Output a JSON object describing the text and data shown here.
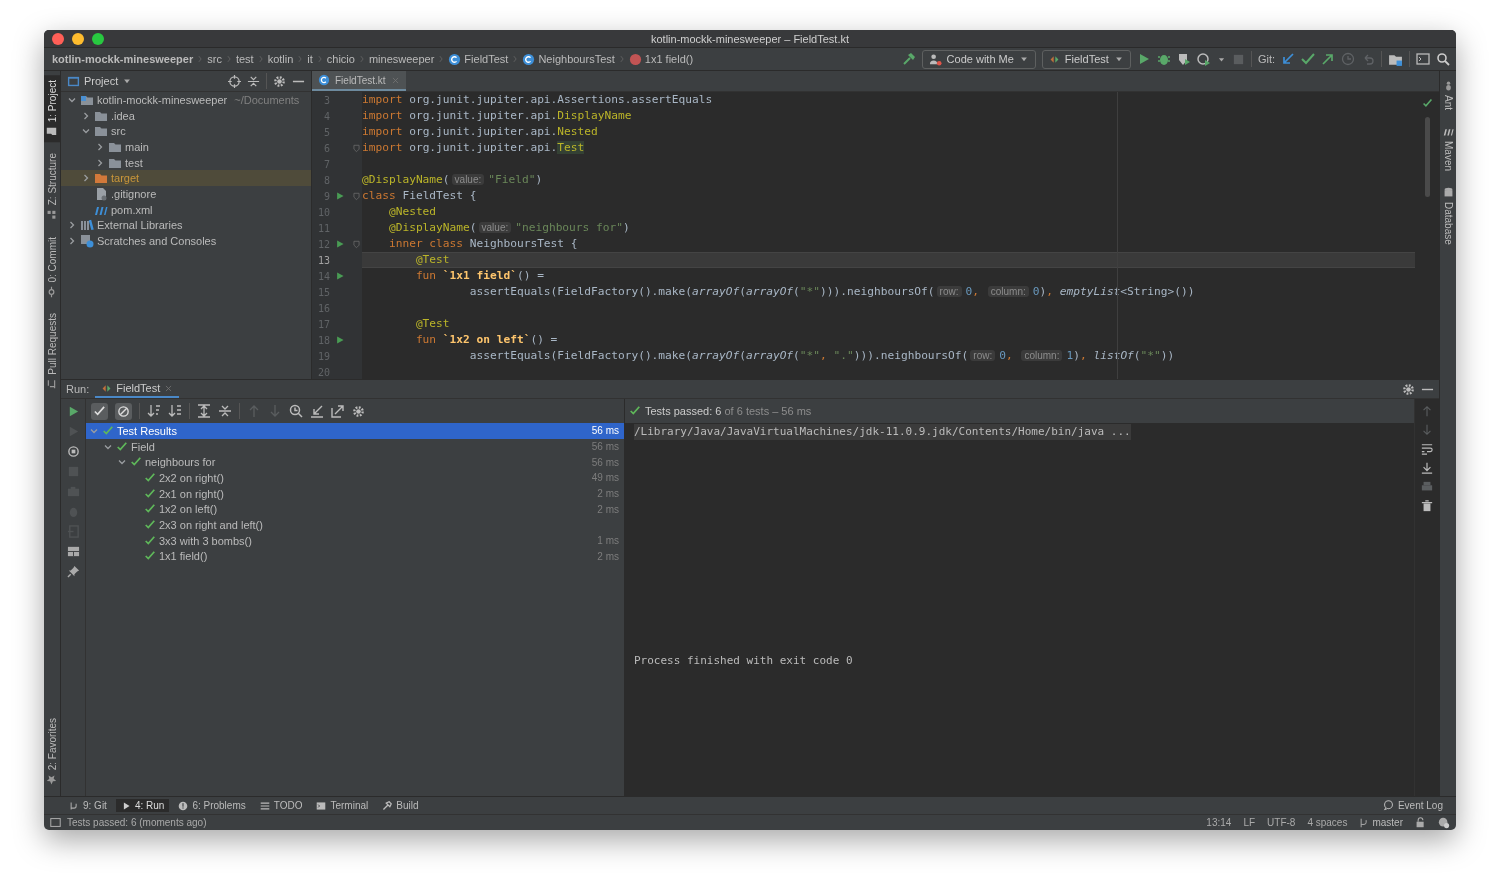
{
  "window": {
    "title": "kotlin-mockk-minesweeper – FieldTest.kt"
  },
  "breadcrumbs": [
    {
      "label": "kotlin-mockk-minesweeper",
      "kind": "project"
    },
    {
      "label": "src",
      "kind": "package"
    },
    {
      "label": "test",
      "kind": "package"
    },
    {
      "label": "kotlin",
      "kind": "package"
    },
    {
      "label": "it",
      "kind": "package"
    },
    {
      "label": "chicio",
      "kind": "package"
    },
    {
      "label": "minesweeper",
      "kind": "package"
    },
    {
      "label": "FieldTest",
      "kind": "class"
    },
    {
      "label": "NeighboursTest",
      "kind": "class"
    },
    {
      "label": "1x1 field()",
      "kind": "method"
    }
  ],
  "toolbar": {
    "code_with_me": "Code with Me",
    "run_config": "FieldTest",
    "git_label": "Git:"
  },
  "left_strip": [
    {
      "label": "1: Project",
      "kind": "project",
      "selected": true
    },
    {
      "label": "Z: Structure",
      "kind": "structure",
      "selected": false
    },
    {
      "label": "0: Commit",
      "kind": "commit",
      "selected": false
    },
    {
      "label": "Pull Requests",
      "kind": "pull-requests",
      "selected": false
    }
  ],
  "left_strip_bottom": [
    {
      "label": "2: Favorites",
      "kind": "favorites",
      "selected": false
    }
  ],
  "right_strip": [
    {
      "label": "Ant",
      "kind": "ant"
    },
    {
      "label": "Maven",
      "kind": "maven"
    },
    {
      "label": "Database",
      "kind": "database"
    }
  ],
  "project_panel": {
    "title": "Project",
    "tree": [
      {
        "label": "kotlin-mockk-minesweeper",
        "note": "~/Documents",
        "kind": "module",
        "expanded": true,
        "selected": false,
        "children": [
          {
            "label": ".idea",
            "kind": "folder",
            "expanded": false,
            "selected": false
          },
          {
            "label": "src",
            "kind": "folder",
            "expanded": true,
            "selected": false,
            "children": [
              {
                "label": "main",
                "kind": "folder",
                "expanded": false,
                "selected": false
              },
              {
                "label": "test",
                "kind": "folder",
                "expanded": false,
                "selected": false
              }
            ]
          },
          {
            "label": "target",
            "kind": "excluded-folder",
            "expanded": false,
            "selected": true
          },
          {
            "label": ".gitignore",
            "kind": "file",
            "selected": false
          },
          {
            "label": "pom.xml",
            "kind": "maven",
            "selected": false
          }
        ]
      },
      {
        "label": "External Libraries",
        "kind": "libraries",
        "expanded": false,
        "selected": false
      },
      {
        "label": "Scratches and Consoles",
        "kind": "scratches",
        "expanded": false,
        "selected": false
      }
    ]
  },
  "editor": {
    "tabs": [
      {
        "label": "FieldTest.kt",
        "selected": true
      }
    ],
    "lines": [
      {
        "number": "3",
        "current": false,
        "runnable": false,
        "fold": false,
        "tokens": [
          {
            "kind": "kw",
            "text": "import"
          },
          {
            "kind": "plain",
            "text": " org.junit.jupiter.api.Assertions.assertEquals"
          }
        ]
      },
      {
        "number": "4",
        "current": false,
        "runnable": false,
        "fold": false,
        "tokens": [
          {
            "kind": "kw",
            "text": "import"
          },
          {
            "kind": "plain",
            "text": " org.junit.jupiter.api."
          },
          {
            "kind": "ann",
            "text": "DisplayName"
          }
        ]
      },
      {
        "number": "5",
        "current": false,
        "runnable": false,
        "fold": false,
        "tokens": [
          {
            "kind": "kw",
            "text": "import"
          },
          {
            "kind": "plain",
            "text": " org.junit.jupiter.api."
          },
          {
            "kind": "ann",
            "text": "Nested"
          }
        ]
      },
      {
        "number": "6",
        "current": false,
        "runnable": false,
        "fold": true,
        "tokens": [
          {
            "kind": "kw",
            "text": "import"
          },
          {
            "kind": "plain",
            "text": " org.junit.jupiter.api."
          },
          {
            "kind": "ann-hl",
            "text": "Test"
          }
        ]
      },
      {
        "number": "7",
        "current": false,
        "runnable": false,
        "fold": false
      },
      {
        "number": "8",
        "current": false,
        "runnable": false,
        "fold": false,
        "tokens": [
          {
            "kind": "ann",
            "text": "@DisplayName"
          },
          {
            "kind": "plain",
            "text": "("
          },
          {
            "kind": "hint",
            "text": "value:"
          },
          {
            "kind": "str",
            "text": "\"Field\""
          },
          {
            "kind": "plain",
            "text": ")"
          }
        ]
      },
      {
        "number": "9",
        "current": false,
        "runnable": true,
        "fold": true,
        "tokens": [
          {
            "kind": "kw",
            "text": "class"
          },
          {
            "kind": "plain",
            "text": " FieldTest {"
          }
        ]
      },
      {
        "number": "10",
        "current": false,
        "runnable": false,
        "fold": false,
        "tokens": [
          {
            "kind": "ann",
            "text": "    @Nested"
          }
        ]
      },
      {
        "number": "11",
        "current": false,
        "runnable": false,
        "fold": false,
        "tokens": [
          {
            "kind": "ann",
            "text": "    @DisplayName"
          },
          {
            "kind": "plain",
            "text": "("
          },
          {
            "kind": "hint",
            "text": "value:"
          },
          {
            "kind": "str",
            "text": "\"neighbours for\""
          },
          {
            "kind": "plain",
            "text": ")"
          }
        ]
      },
      {
        "number": "12",
        "current": false,
        "runnable": true,
        "fold": true,
        "tokens": [
          {
            "kind": "kw",
            "text": "    inner class"
          },
          {
            "kind": "plain",
            "text": " NeighboursTest {"
          }
        ]
      },
      {
        "number": "13",
        "current": true,
        "runnable": false,
        "fold": false,
        "tokens": [
          {
            "kind": "ann",
            "text": "        @Test"
          }
        ]
      },
      {
        "number": "14",
        "current": false,
        "runnable": true,
        "fold": false,
        "tokens": [
          {
            "kind": "kw",
            "text": "        fun "
          },
          {
            "kind": "name",
            "text": "`1x1 field`"
          },
          {
            "kind": "plain",
            "text": "() ="
          }
        ]
      },
      {
        "number": "15",
        "current": false,
        "runnable": false,
        "fold": false,
        "tokens": [
          {
            "kind": "plain",
            "text": "                assertEquals(FieldFactory().make("
          },
          {
            "kind": "fn",
            "text": "arrayOf"
          },
          {
            "kind": "plain",
            "text": "("
          },
          {
            "kind": "fn",
            "text": "arrayOf"
          },
          {
            "kind": "plain",
            "text": "("
          },
          {
            "kind": "str",
            "text": "\"*\""
          },
          {
            "kind": "plain",
            "text": "))).neighboursOf("
          },
          {
            "kind": "hint",
            "text": "row:"
          },
          {
            "kind": "num",
            "text": "0"
          },
          {
            "kind": "kw",
            "text": ", "
          },
          {
            "kind": "hint",
            "text": "column:"
          },
          {
            "kind": "num",
            "text": "0"
          },
          {
            "kind": "plain",
            "text": ")"
          },
          {
            "kind": "kw",
            "text": ", "
          },
          {
            "kind": "fn",
            "text": "emptyList"
          },
          {
            "kind": "plain",
            "text": "<String>())"
          }
        ]
      },
      {
        "number": "16",
        "current": false,
        "runnable": false,
        "fold": false
      },
      {
        "number": "17",
        "current": false,
        "runnable": false,
        "fold": false,
        "tokens": [
          {
            "kind": "ann",
            "text": "        @Test"
          }
        ]
      },
      {
        "number": "18",
        "current": false,
        "runnable": true,
        "fold": false,
        "tokens": [
          {
            "kind": "kw",
            "text": "        fun "
          },
          {
            "kind": "name",
            "text": "`1x2 on left`"
          },
          {
            "kind": "plain",
            "text": "() ="
          }
        ]
      },
      {
        "number": "19",
        "current": false,
        "runnable": false,
        "fold": false,
        "tokens": [
          {
            "kind": "plain",
            "text": "                assertEquals(FieldFactory().make("
          },
          {
            "kind": "fn",
            "text": "arrayOf"
          },
          {
            "kind": "plain",
            "text": "("
          },
          {
            "kind": "fn",
            "text": "arrayOf"
          },
          {
            "kind": "plain",
            "text": "("
          },
          {
            "kind": "str",
            "text": "\"*\""
          },
          {
            "kind": "kw",
            "text": ", "
          },
          {
            "kind": "str",
            "text": "\".\""
          },
          {
            "kind": "plain",
            "text": "))).neighboursOf("
          },
          {
            "kind": "hint",
            "text": "row:"
          },
          {
            "kind": "num",
            "text": "0"
          },
          {
            "kind": "kw",
            "text": ", "
          },
          {
            "kind": "hint",
            "text": "column:"
          },
          {
            "kind": "num",
            "text": "1"
          },
          {
            "kind": "plain",
            "text": ")"
          },
          {
            "kind": "kw",
            "text": ", "
          },
          {
            "kind": "fn",
            "text": "listOf"
          },
          {
            "kind": "plain",
            "text": "("
          },
          {
            "kind": "str",
            "text": "\"*\""
          },
          {
            "kind": "plain",
            "text": "))"
          }
        ]
      },
      {
        "number": "20",
        "current": false,
        "runnable": false,
        "fold": false
      }
    ]
  },
  "run_panel": {
    "label": "Run:",
    "tabs": [
      {
        "label": "FieldTest",
        "selected": true
      }
    ],
    "summary": "**Tests passed: 6** of 6 tests – 56 ms",
    "tests": [
      {
        "label": "Test Results",
        "time": "56 ms",
        "expanded": true,
        "selected": true,
        "children": [
          {
            "label": "Field",
            "time": "56 ms",
            "expanded": true,
            "selected": false,
            "children": [
              {
                "label": "neighbours for",
                "time": "56 ms",
                "expanded": true,
                "selected": false,
                "children": [
                  {
                    "label": "2x2 on right()",
                    "time": "49 ms",
                    "selected": false
                  },
                  {
                    "label": "2x1 on right()",
                    "time": "2 ms",
                    "selected": false
                  },
                  {
                    "label": "1x2 on left()",
                    "time": "2 ms",
                    "selected": false
                  },
                  {
                    "label": "2x3 on right and left()",
                    "selected": false
                  },
                  {
                    "label": "3x3 with 3 bombs()",
                    "time": "1 ms",
                    "selected": false
                  },
                  {
                    "label": "1x1 field()",
                    "time": "2 ms",
                    "selected": false
                  }
                ]
              }
            ]
          }
        ]
      }
    ],
    "console": [
      {
        "kind": "command",
        "text": "/Library/Java/JavaVirtualMachines/jdk-11.0.9.jdk/Contents/Home/bin/java ..."
      },
      {
        "kind": "exit",
        "text": "Process finished with exit code 0"
      }
    ]
  },
  "tool_windows": [
    {
      "label": "9: Git",
      "kind": "git",
      "selected": false
    },
    {
      "label": "4: Run",
      "kind": "run",
      "selected": true
    },
    {
      "label": "6: Problems",
      "kind": "problems",
      "selected": false
    },
    {
      "label": "TODO",
      "kind": "todo",
      "selected": false
    },
    {
      "label": "Terminal",
      "kind": "terminal",
      "selected": false
    },
    {
      "label": "Build",
      "kind": "build",
      "selected": false
    }
  ],
  "event_log": "Event Log",
  "status_bar": {
    "message": "Tests passed: 6 (moments ago)",
    "items": [
      "13:14",
      "LF",
      "UTF-8",
      "4 spaces"
    ],
    "branch": "master"
  }
}
